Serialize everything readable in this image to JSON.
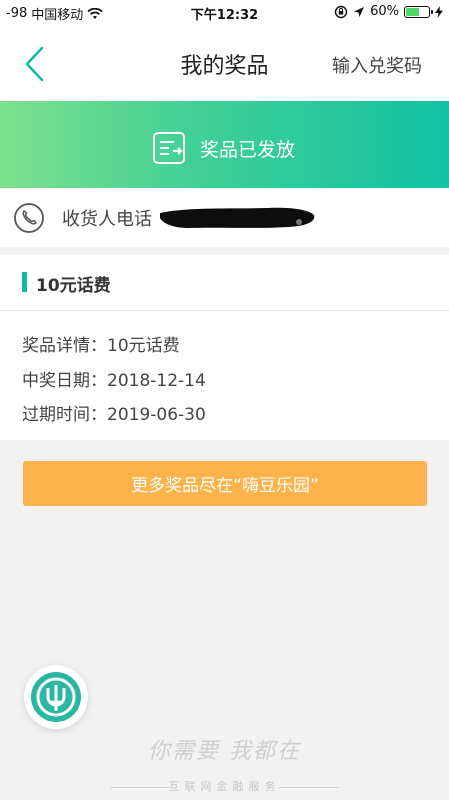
{
  "status_bar": {
    "signal": "-98",
    "carrier": "中国移动",
    "time": "下午12:32",
    "battery": "60%",
    "battery_level": 0.6
  },
  "nav": {
    "title": "我的奖品",
    "redeem_code": "输入兑奖码"
  },
  "banner": {
    "status": "奖品已发放"
  },
  "phone": {
    "label": "收货人电话"
  },
  "prize": {
    "title": "10元话费",
    "details": [
      {
        "label": "奖品详情：",
        "value": "10元话费"
      },
      {
        "label": "中奖日期：",
        "value": "2018-12-14"
      },
      {
        "label": "过期时间：",
        "value": "2019-06-30"
      }
    ]
  },
  "cta": {
    "label": "更多奖品尽在“嗨豆乐园”"
  },
  "watermark": {
    "script": "你需要 我都在",
    "subtitle": "互联网金融服务"
  },
  "colors": {
    "accent": "#13b99d",
    "button": "#fdb24a",
    "banner_start": "#7ee08d",
    "banner_end": "#12c2a3"
  }
}
